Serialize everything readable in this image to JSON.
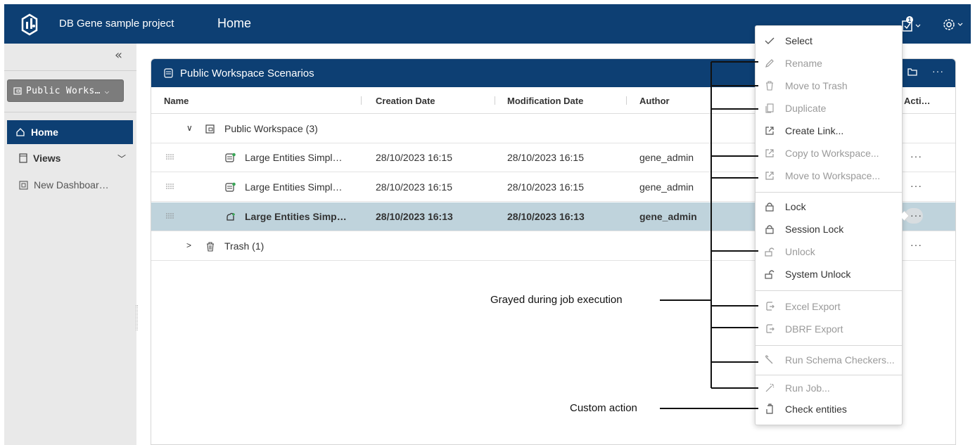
{
  "app": {
    "title": "DB Gene sample project",
    "page_title": "Home"
  },
  "sidebar": {
    "workspace_select": "Public Works…",
    "items": [
      {
        "label": "Home"
      },
      {
        "label": "Views"
      },
      {
        "label": "New Dashboar…"
      }
    ]
  },
  "panel": {
    "title": "Public Workspace Scenarios",
    "columns": [
      "Name",
      "Creation Date",
      "Modification Date",
      "Author",
      "Acti…"
    ],
    "group": "Public Workspace (3)",
    "rows": [
      {
        "name": "Large Entities Simpl…",
        "created": "28/10/2023 16:15",
        "modified": "28/10/2023 16:15",
        "author": "gene_admin"
      },
      {
        "name": "Large Entities Simpl…",
        "created": "28/10/2023 16:15",
        "modified": "28/10/2023 16:15",
        "author": "gene_admin"
      },
      {
        "name": "Large Entities Simp…",
        "created": "28/10/2023 16:13",
        "modified": "28/10/2023 16:13",
        "author": "gene_admin"
      }
    ],
    "trash": "Trash (1)",
    "more": "···"
  },
  "menu": {
    "items": [
      {
        "label": "Select",
        "icon": "check-icon"
      },
      {
        "label": "Rename",
        "icon": "pencil-icon"
      },
      {
        "label": "Move to Trash",
        "icon": "trash-icon"
      },
      {
        "label": "Duplicate",
        "icon": "copy-icon"
      },
      {
        "label": "Create Link...",
        "icon": "link-out-icon"
      },
      {
        "label": "Copy to Workspace...",
        "icon": "link-out-icon"
      },
      {
        "label": "Move to Workspace...",
        "icon": "link-out-icon"
      },
      {
        "label": "Lock",
        "icon": "lock-icon"
      },
      {
        "label": "Session Lock",
        "icon": "lock-icon"
      },
      {
        "label": "Unlock",
        "icon": "unlock-icon"
      },
      {
        "label": "System Unlock",
        "icon": "unlock-icon"
      },
      {
        "label": "Excel Export",
        "icon": "export-icon"
      },
      {
        "label": "DBRF Export",
        "icon": "export-icon"
      },
      {
        "label": "Run Schema Checkers...",
        "icon": "wrench-icon"
      },
      {
        "label": "Run Job...",
        "icon": "wand-icon"
      },
      {
        "label": "Check entities",
        "icon": "clipboard-icon"
      }
    ]
  },
  "annotations": {
    "grayed": "Grayed during job execution",
    "custom": "Custom action"
  },
  "colors": {
    "header": "#0d3f73",
    "selected_row": "#bfd3dc",
    "sidebar": "#e9e9e9"
  }
}
